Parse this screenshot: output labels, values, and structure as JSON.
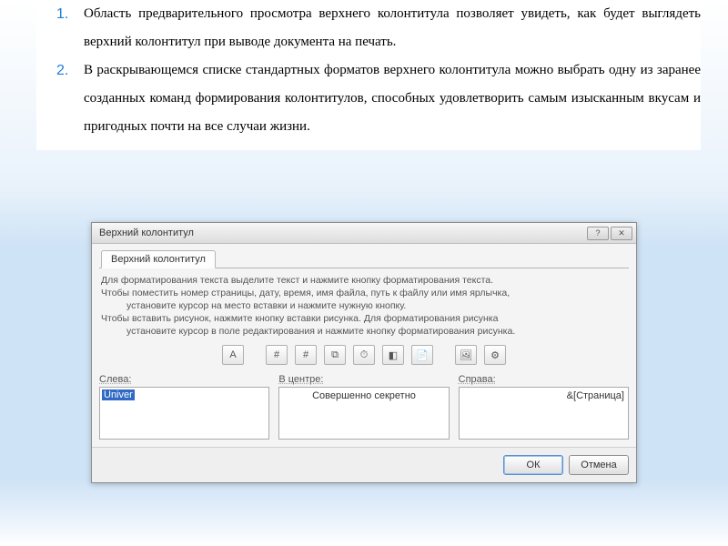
{
  "list": {
    "items": [
      "Область предварительного просмотра верхнего колонтитула позволяет увидеть, как будет выглядеть верхний колонтитул при выводе документа на печать.",
      "В раскрывающемся списке стандартных форматов верхнего колонтитула можно выбрать одну из заранее созданных команд формирования колонтитулов, способных удовлетворить самым изысканным вкусам и пригодных почти на все случаи жизни."
    ]
  },
  "dialog": {
    "title": "Верхний колонтитул",
    "tab": "Верхний колонтитул",
    "help": {
      "l1": "Для форматирования текста выделите текст и нажмите кнопку форматирования текста.",
      "l2": "Чтобы поместить номер страницы, дату, время, имя файла, путь к файлу или имя ярлычка,",
      "l2b": "установите курсор на место вставки и нажмите нужную кнопку.",
      "l3": "Чтобы вставить рисунок, нажмите кнопку вставки рисунка.  Для форматирования рисунка",
      "l3b": "установите курсор в поле редактирования и нажмите кнопку форматирования рисунка."
    },
    "toolbar_icons": [
      "A",
      "#",
      "#",
      "⧉",
      "⏱",
      "◧",
      "📄",
      "🖼",
      "⚙"
    ],
    "columns": {
      "left": {
        "label": "Слева:",
        "value": "Univer"
      },
      "center": {
        "label": "В центре:",
        "value": "Совершенно секретно"
      },
      "right": {
        "label": "Справа:",
        "value": "&[Страница]"
      }
    },
    "buttons": {
      "ok": "ОК",
      "cancel": "Отмена"
    },
    "winbuttons": {
      "help": "?",
      "close": "✕"
    }
  }
}
